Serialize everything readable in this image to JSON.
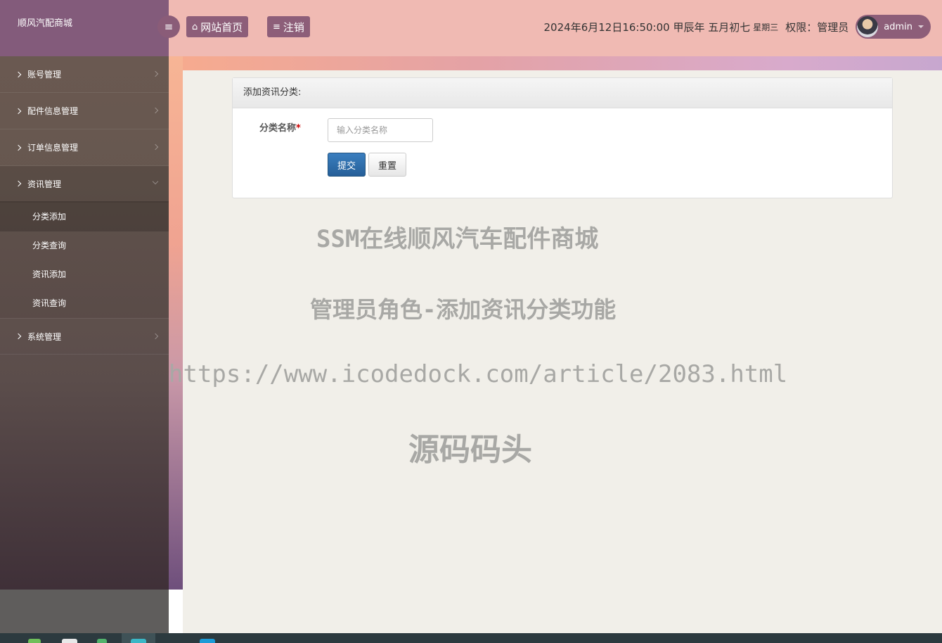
{
  "sidebar": {
    "brand": "顺风汽配商城",
    "menus": [
      {
        "label": "账号管理"
      },
      {
        "label": "配件信息管理"
      },
      {
        "label": "订单信息管理"
      },
      {
        "label": "资讯管理",
        "open": true,
        "children": [
          {
            "label": "分类添加",
            "active": true
          },
          {
            "label": "分类查询"
          },
          {
            "label": "资讯添加"
          },
          {
            "label": "资讯查询"
          }
        ]
      },
      {
        "label": "系统管理"
      }
    ]
  },
  "topbar": {
    "toggle_icon": "bars-icon",
    "home_label": "网站首页",
    "logout_label": "注销",
    "datetime": "2024年6月12日16:50:00 甲辰年 五月初七",
    "weekday": "星期三",
    "permission": "权限：管理员",
    "username": "admin"
  },
  "panel": {
    "title": "添加资讯分类:",
    "field_label": "分类名称",
    "required_mark": "*",
    "placeholder": "输入分类名称",
    "value": "",
    "submit_label": "提交",
    "reset_label": "重置"
  },
  "watermark": {
    "line1": "SSM在线顺风汽车配件商城",
    "line2": "管理员角色-添加资讯分类功能",
    "line3": "https://www.icodedock.com/article/2083.html",
    "line4": "源码码头"
  },
  "colors": {
    "sidebar_brand": "#835b7b",
    "topbar_bg": "#f0bab3",
    "accent_button": "#8d5e79",
    "primary_button": "#2f6da8"
  }
}
